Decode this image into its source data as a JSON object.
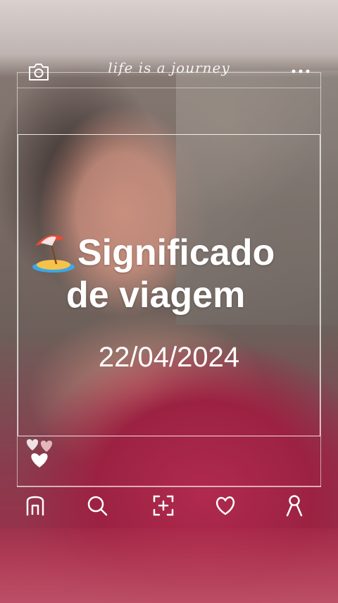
{
  "header": {
    "tagline": "life is a journey",
    "camera_icon": "camera-icon",
    "more_icon": "more-dots-icon"
  },
  "main": {
    "title_icon": "beach-umbrella-icon",
    "title_line1": "Significado",
    "title_line2": "de viagem",
    "date": "22/04/2024"
  },
  "reactions": {
    "icon": "hearts-icon"
  },
  "nav": {
    "items": [
      {
        "icon": "home-icon"
      },
      {
        "icon": "search-icon"
      },
      {
        "icon": "add-frame-icon"
      },
      {
        "icon": "heart-icon"
      },
      {
        "icon": "profile-icon"
      }
    ]
  },
  "colors": {
    "text": "#ffffff",
    "dress": "#a3284a"
  }
}
